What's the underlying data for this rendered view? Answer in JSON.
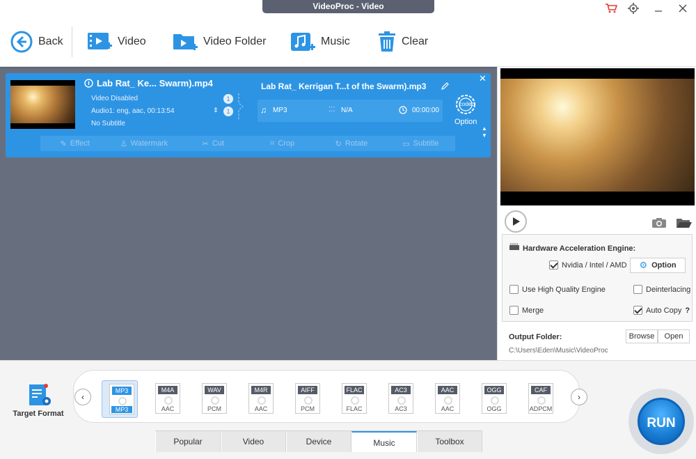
{
  "window": {
    "title": "VideoProc - Video"
  },
  "toolbar": {
    "back_label": "Back",
    "video_label": "Video",
    "video_folder_label": "Video Folder",
    "music_label": "Music",
    "clear_label": "Clear"
  },
  "item": {
    "source_name": "Lab Rat_ Ke... Swarm).mp4",
    "video_status": "Video Disabled",
    "audio_info": "Audio1: eng, aac, 00:13:54",
    "subtitle_info": "No Subtitle",
    "video_track_count": "1",
    "audio_track_count": "1",
    "output_name": "Lab Rat_ Kerrigan T...t of the Swarm).mp3",
    "output_format": "MP3",
    "output_resolution": "N/A",
    "output_duration": "00:00:00",
    "codec_label": "codec",
    "option_label": "Option",
    "edit_tabs": [
      "Effect",
      "Watermark",
      "Cut",
      "Crop",
      "Rotate",
      "Subtitle"
    ]
  },
  "settings": {
    "hw_title": "Hardware Acceleration Engine:",
    "hw_checkbox": "Nvidia / Intel / AMD",
    "hw_checked": true,
    "option_button": "Option",
    "high_quality": "Use High Quality Engine",
    "high_quality_checked": false,
    "deinterlacing": "Deinterlacing",
    "deinterlacing_checked": false,
    "merge": "Merge",
    "merge_checked": false,
    "auto_copy": "Auto Copy",
    "auto_copy_checked": true,
    "help": "?",
    "output_folder_label": "Output Folder:",
    "output_folder_path": "C:\\Users\\Eden\\Music\\VideoProc",
    "browse_button": "Browse",
    "open_button": "Open"
  },
  "formats": {
    "target_label": "Target Format",
    "items": [
      {
        "tag": "MP3",
        "sub": "MP3",
        "selected": true
      },
      {
        "tag": "M4A",
        "sub": "AAC",
        "selected": false
      },
      {
        "tag": "WAV",
        "sub": "PCM",
        "selected": false
      },
      {
        "tag": "M4R",
        "sub": "AAC",
        "selected": false
      },
      {
        "tag": "AIFF",
        "sub": "PCM",
        "selected": false
      },
      {
        "tag": "FLAC",
        "sub": "FLAC",
        "selected": false
      },
      {
        "tag": "AC3",
        "sub": "AC3",
        "selected": false
      },
      {
        "tag": "AAC",
        "sub": "AAC",
        "selected": false
      },
      {
        "tag": "OGG",
        "sub": "OGG",
        "selected": false
      },
      {
        "tag": "CAF",
        "sub": "ADPCM",
        "selected": false
      }
    ]
  },
  "tabs": {
    "items": [
      "Popular",
      "Video",
      "Device",
      "Music",
      "Toolbox"
    ],
    "active": "Music"
  },
  "run_label": "RUN",
  "colors": {
    "accent": "#2d94e4",
    "workspace": "#676f7f",
    "run": "#1a7fd6",
    "cart": "#e53935"
  }
}
